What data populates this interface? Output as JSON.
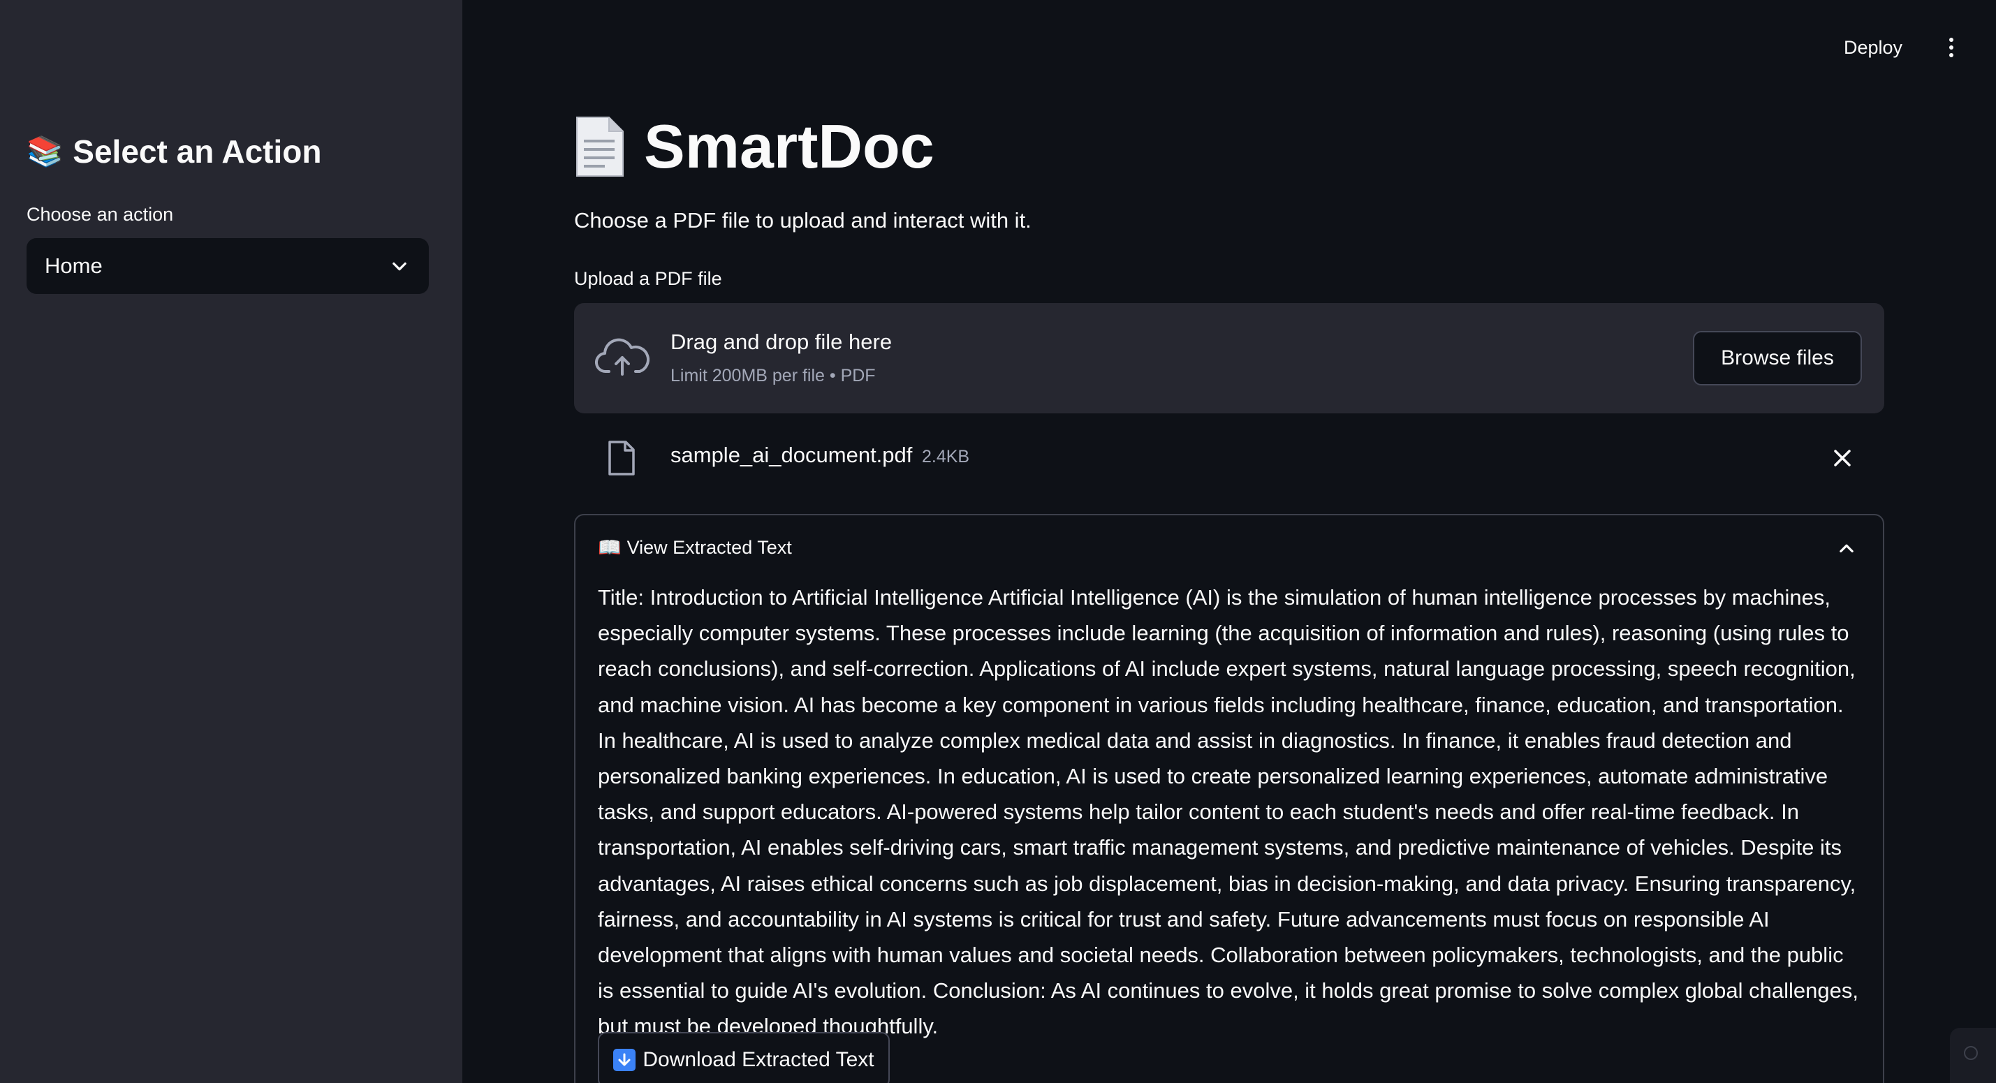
{
  "sidebar": {
    "title_emoji": "📚",
    "title": "Select an Action",
    "select_label": "Choose an action",
    "select_value": "Home"
  },
  "header": {
    "deploy_label": "Deploy"
  },
  "main": {
    "title": "SmartDoc",
    "intro": "Choose a PDF file to upload and interact with it.",
    "upload_label": "Upload a PDF file",
    "dropzone": {
      "main_text": "Drag and drop file here",
      "sub_text": "Limit 200MB per file • PDF",
      "browse_label": "Browse files"
    },
    "file": {
      "name": "sample_ai_document.pdf",
      "size": "2.4KB"
    },
    "expander": {
      "emoji": "📖",
      "title": "View Extracted Text",
      "body": "Title: Introduction to Artificial Intelligence Artificial Intelligence (AI) is the simulation of human intelligence processes by machines, especially computer systems. These processes include learning (the acquisition of information and rules), reasoning (using rules to reach conclusions), and self-correction. Applications of AI include expert systems, natural language processing, speech recognition, and machine vision. AI has become a key component in various fields including healthcare, finance, education, and transportation. In healthcare, AI is used to analyze complex medical data and assist in diagnostics. In finance, it enables fraud detection and personalized banking experiences. In education, AI is used to create personalized learning experiences, automate administrative tasks, and support educators. AI-powered systems help tailor content to each student's needs and offer real-time feedback. In transportation, AI enables self-driving cars, smart traffic management systems, and predictive maintenance of vehicles. Despite its advantages, AI raises ethical concerns such as job displacement, bias in decision-making, and data privacy. Ensuring transparency, fairness, and accountability in AI systems is critical for trust and safety. Future advancements must focus on responsible AI development that aligns with human values and societal needs. Collaboration between policymakers, technologists, and the public is essential to guide AI's evolution. Conclusion: As AI continues to evolve, it holds great promise to solve complex global challenges, but must be developed thoughtfully.",
      "download_label": "Download Extracted Text"
    }
  },
  "icons": {
    "select_chevron": "chevron-down-icon",
    "title_icon": "document-icon",
    "upload_icon": "cloud-upload-icon",
    "file_icon": "file-icon",
    "remove_icon": "close-icon",
    "expander_chevron": "chevron-up-icon",
    "download_icon": "down-arrow-icon",
    "menu_icon": "kebab-menu-icon"
  },
  "colors": {
    "background": "#0e1117",
    "sidebar": "#262730",
    "text": "#fafafa",
    "muted_text": "#a3a8b8",
    "border": "#3d404b"
  }
}
